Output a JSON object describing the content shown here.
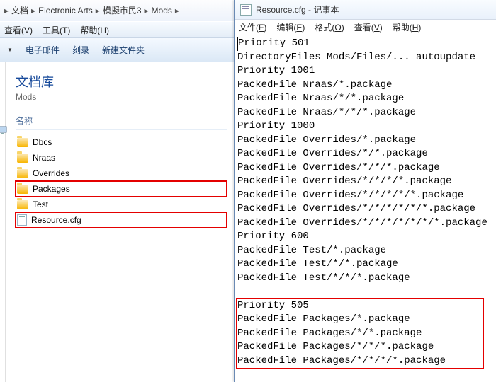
{
  "explorer": {
    "breadcrumb": [
      "文档",
      "Electronic Arts",
      "模擬市民3",
      "Mods"
    ],
    "menu": {
      "view": "查看(V)",
      "tools": "工具(T)",
      "help": "帮助(H)"
    },
    "toolbar": {
      "email": "电子邮件",
      "burn": "刻录",
      "newfolder": "新建文件夹"
    },
    "lib_title": "文档库",
    "lib_sub": "Mods",
    "col_name": "名称",
    "items": [
      {
        "name": "Dbcs",
        "type": "folder",
        "hl": false
      },
      {
        "name": "Nraas",
        "type": "folder",
        "hl": false
      },
      {
        "name": "Overrides",
        "type": "folder",
        "hl": false
      },
      {
        "name": "Packages",
        "type": "folder",
        "hl": true
      },
      {
        "name": "Test",
        "type": "folder",
        "hl": false
      },
      {
        "name": "Resource.cfg",
        "type": "file",
        "hl": true
      }
    ]
  },
  "notepad": {
    "title": "Resource.cfg - 记事本",
    "menu": {
      "file": "文件(F)",
      "edit": "编辑(E)",
      "format": "格式(O)",
      "view": "查看(V)",
      "help": "帮助(H)"
    },
    "lines": [
      "Priority 501",
      "DirectoryFiles  Mods/Files/... autoupdate",
      "Priority 1001",
      "PackedFile Nraas/*.package",
      "PackedFile Nraas/*/*.package",
      "PackedFile Nraas/*/*/*.package",
      "Priority 1000",
      "PackedFile Overrides/*.package",
      "PackedFile Overrides/*/*.package",
      "PackedFile Overrides/*/*/*.package",
      "PackedFile Overrides/*/*/*/*.package",
      "PackedFile Overrides/*/*/*/*/*.package",
      "PackedFile Overrides/*/*/*/*/*/*.package",
      "PackedFile Overrides/*/*/*/*/*/*/*.package",
      "Priority 600",
      "PackedFile Test/*.package",
      "PackedFile Test/*/*.package",
      "PackedFile Test/*/*/*.package",
      "",
      "Priority 505",
      "PackedFile Packages/*.package",
      "PackedFile Packages/*/*.package",
      "PackedFile Packages/*/*/*.package",
      "PackedFile Packages/*/*/*/*.package"
    ]
  }
}
